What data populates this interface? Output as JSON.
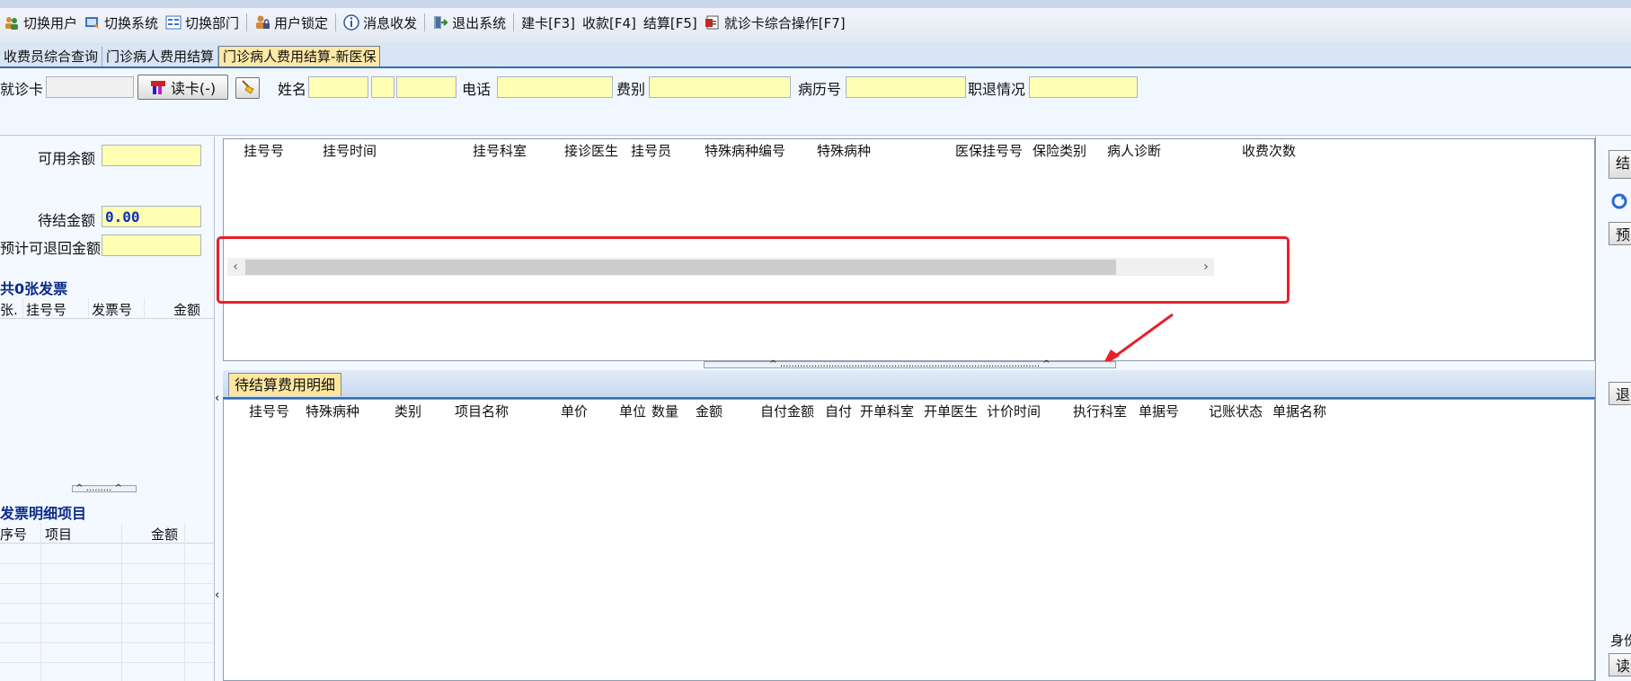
{
  "toolbar": {
    "items": [
      {
        "label": "切换用户",
        "icon": "users-icon"
      },
      {
        "label": "切换系统",
        "icon": "switch-system-icon"
      },
      {
        "label": "切换部门",
        "icon": "department-icon"
      },
      {
        "label": "用户锁定",
        "icon": "lock-user-icon"
      },
      {
        "label": "消息收发",
        "icon": "info-icon"
      },
      {
        "label": "退出系统",
        "icon": "exit-icon"
      },
      {
        "label": "建卡[F3]"
      },
      {
        "label": "收款[F4]"
      },
      {
        "label": "结算[F5]"
      },
      {
        "label": "就诊卡综合操作[F7]",
        "icon": "card-operation-icon"
      }
    ]
  },
  "tabs": [
    {
      "label": "收费员综合查询",
      "active": false
    },
    {
      "label": "门诊病人费用结算",
      "active": false
    },
    {
      "label": "门诊病人费用结算-新医保",
      "active": true
    }
  ],
  "cardrow": {
    "card_label": "就诊卡",
    "read_card_button": "读卡(-)",
    "name_label": "姓名",
    "phone_label": "电话",
    "fee_type_label": "费别",
    "record_no_label": "病历号",
    "employment_label": "职退情况"
  },
  "left": {
    "available_balance_label": "可用余额",
    "pending_amount_label": "待结金额",
    "pending_amount_value": "0.00",
    "refund_label": "预计可退回金额",
    "invoice_count_title": "共0张发票",
    "invoice_headers": [
      "张.",
      "挂号号",
      "发票号",
      "金额"
    ],
    "invoice_detail_title": "发票明细项目",
    "detail_headers": [
      "序号",
      "项目",
      "金额"
    ]
  },
  "grid1": {
    "headers": [
      "挂号号",
      "挂号时间",
      "挂号科室",
      "接诊医生",
      "挂号员",
      "特殊病种编号",
      "特殊病种",
      "医保挂号号",
      "保险类别",
      "病人诊断",
      "收费次数"
    ]
  },
  "grid2": {
    "tab_label": "待结算费用明细",
    "headers": [
      "挂号号",
      "特殊病种",
      "类别",
      "项目名称",
      "单价",
      "单位",
      "数量",
      "金额",
      "自付金额",
      "自付",
      "开单科室",
      "开单医生",
      "计价时间",
      "执行科室",
      "单据号",
      "记账状态",
      "单据名称"
    ]
  },
  "right": {
    "btn_settle": "结",
    "btn_pre": "预",
    "btn_back": "退",
    "id_label": "身份",
    "read_label": "读卡"
  },
  "colors": {
    "accent": "#2e6fb6",
    "input_yellow": "#ffffb3",
    "highlight_red": "#e8202a"
  }
}
